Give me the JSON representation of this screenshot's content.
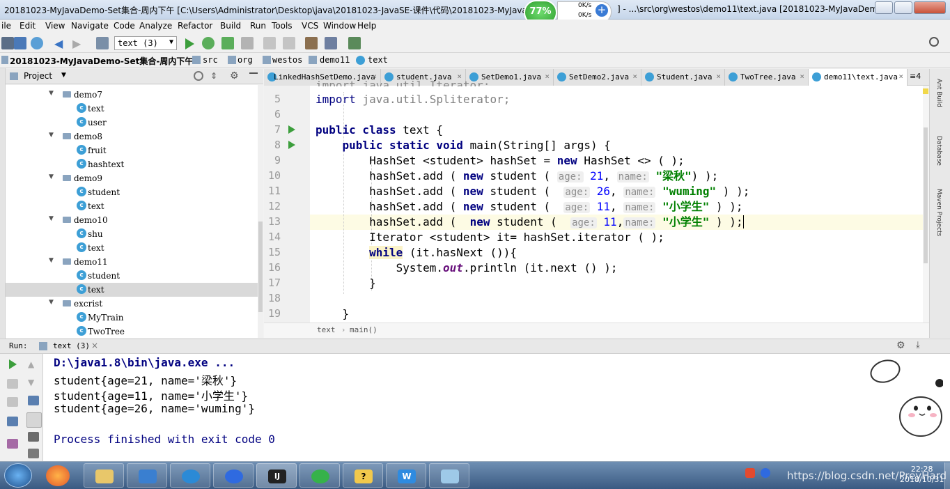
{
  "window": {
    "title": "20181023-MyJavaDemo-Set集合-周内下午 [C:\\Users\\Administrator\\Desktop\\java\\20181023-JavaSE-课件\\代码\\20181023-MyJavaD",
    "title_suffix": "] - ...\\src\\org\\westos\\demo11\\text.java [20181023-MyJavaDem...",
    "overlay_percent": "77%",
    "net_up": "0K/s",
    "net_down": "0K/s"
  },
  "menu": [
    "ile",
    "Edit",
    "View",
    "Navigate",
    "Code",
    "Analyze",
    "Refactor",
    "Build",
    "Run",
    "Tools",
    "VCS",
    "Window",
    "Help"
  ],
  "toolbar": {
    "run_config": "text (3)"
  },
  "navbar": {
    "project": "20181023-MyJavaDemo-Set集合-周内下午",
    "crumbs": [
      "src",
      "org",
      "westos",
      "demo11",
      "text"
    ]
  },
  "project_panel": {
    "title": "Project",
    "tree": [
      {
        "label": "demo7",
        "kind": "folder"
      },
      {
        "label": "text",
        "kind": "class"
      },
      {
        "label": "user",
        "kind": "class"
      },
      {
        "label": "demo8",
        "kind": "folder"
      },
      {
        "label": "fruit",
        "kind": "class"
      },
      {
        "label": "hashtext",
        "kind": "class"
      },
      {
        "label": "demo9",
        "kind": "folder"
      },
      {
        "label": "student",
        "kind": "class"
      },
      {
        "label": "text",
        "kind": "class"
      },
      {
        "label": "demo10",
        "kind": "folder"
      },
      {
        "label": "shu",
        "kind": "class"
      },
      {
        "label": "text",
        "kind": "class"
      },
      {
        "label": "demo11",
        "kind": "folder"
      },
      {
        "label": "student",
        "kind": "class"
      },
      {
        "label": "text",
        "kind": "class",
        "selected": true
      },
      {
        "label": "excrist",
        "kind": "folder"
      },
      {
        "label": "MyTrain",
        "kind": "class"
      },
      {
        "label": "TwoTree",
        "kind": "class"
      }
    ]
  },
  "tabs": [
    {
      "label": "LinkedHashSetDemo.java",
      "active": false
    },
    {
      "label": "student.java",
      "active": false
    },
    {
      "label": "SetDemo1.java",
      "active": false
    },
    {
      "label": "SetDemo2.java",
      "active": false
    },
    {
      "label": "Student.java",
      "active": false
    },
    {
      "label": "TwoTree.java",
      "active": false
    },
    {
      "label": "demo11\\text.java",
      "active": true
    }
  ],
  "tabs_overflow": "≡4",
  "editor": {
    "line_numbers": [
      "5",
      "6",
      "7",
      "8",
      "9",
      "10",
      "11",
      "12",
      "13",
      "14",
      "15",
      "16",
      "17",
      "18",
      "19"
    ],
    "partial_top_line": "import java.util.Iterator;",
    "lines": {
      "l5a": "import ",
      "l5b": "java.util.Spliterator;",
      "l7a": "public class ",
      "l7b": "text {",
      "l8a": "    public static void ",
      "l8b": "main(String[] args) {",
      "l9a": "        HashSet <student> hashSet = ",
      "l9b": "new ",
      "l9c": "HashSet <> ( );",
      "add": "        hashSet.add ( ",
      "new": "new ",
      "student": "student ( ",
      "hint_age": "age:",
      "hint_name": "name:",
      "l10_age": "21",
      "l10_name": "\"梁秋\"",
      "l10_end": ") );",
      "l11_age": "26",
      "l11_name": "\"wuming\"",
      "l11_end": " ) );",
      "l12_age": "11",
      "l12_name": "\"小学生\"",
      "l12_end": " ) );",
      "l13_age": "11",
      "l13_name": "\"小学生\"",
      "l13_end": " ) );",
      "l14": "        Iterator <student> it= hashSet.iterator ( );",
      "l15a": "while",
      "l15b": " (it.hasNext ()){",
      "l16a": "            System.",
      "l16b": "out",
      "l16c": ".println (it.next () );",
      "l17": "        }",
      "l19": "    }"
    },
    "breadcrumb": [
      "text",
      "main()"
    ]
  },
  "run_panel": {
    "label": "Run:",
    "tab": "text (3)",
    "console": [
      "D:\\java1.8\\bin\\java.exe ...",
      "student{age=21, name='梁秋'}",
      "student{age=11, name='小学生'}",
      "student{age=26, name='wuming'}",
      "",
      "Process finished with exit code 0"
    ]
  },
  "right_strip": [
    "Ant Build",
    "Database",
    "Maven Projects"
  ],
  "taskbar": {
    "clock_time": "22:28",
    "clock_date": "2018/10/31",
    "watermark": "https://blog.csdn.net/PreyHard"
  },
  "colors": {
    "keyword": "#000080",
    "string": "#008000",
    "number": "#0000ff",
    "accent": "#3d9fd6"
  }
}
